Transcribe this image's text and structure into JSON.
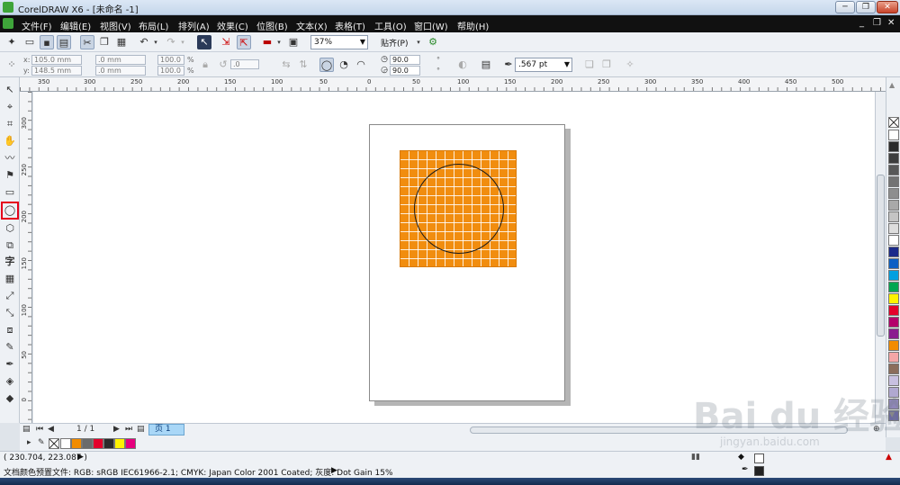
{
  "window": {
    "title": "CorelDRAW X6 - [未命名 -1]",
    "minimize": "─",
    "maximize": "❐",
    "close": "✕"
  },
  "menu": [
    "文件(F)",
    "编辑(E)",
    "视图(V)",
    "布局(L)",
    "排列(A)",
    "效果(C)",
    "位图(B)",
    "文本(X)",
    "表格(T)",
    "工具(O)",
    "窗口(W)",
    "帮助(H)"
  ],
  "mdi_buttons": [
    "_",
    "❐",
    "✕"
  ],
  "standard_toolbar": {
    "zoom": "37%",
    "snap": "贴齐(P)"
  },
  "property_bar": {
    "x_label": "x:",
    "x": "105.0 mm",
    "y_label": "y:",
    "y": "148.5 mm",
    "width": ".0 mm",
    "height": ".0 mm",
    "scale_w": "100.0",
    "scale_h": "100.0",
    "percent": "%",
    "rotation": ".0",
    "angle_start": "90.0",
    "angle_end": "90.0",
    "degree": "°",
    "outline": ".567 pt"
  },
  "ruler": {
    "h_ticks": [
      "350",
      "300",
      "250",
      "200",
      "150",
      "100",
      "50",
      "0",
      "50",
      "100",
      "150",
      "200",
      "250",
      "300",
      "350",
      "400",
      "450",
      "500"
    ],
    "v_ticks": [
      "300",
      "250",
      "200",
      "150",
      "100",
      "50",
      "0"
    ]
  },
  "toolbox_icons": [
    "pick-tool",
    "shape-tool",
    "crop-tool",
    "zoom-tool",
    "freehand-tool",
    "smart-fill-tool",
    "rectangle-tool",
    "ellipse-tool",
    "polygon-tool",
    "basic-shapes-tool",
    "text-tool",
    "table-tool",
    "dimension-tool",
    "connector-tool",
    "blend-tool",
    "eyedropper-tool",
    "outline-tool",
    "fill-tool",
    "interactive-fill-tool"
  ],
  "palette_colors": [
    "#ffffff",
    "#2b2b2b",
    "#3d3d3d",
    "#585858",
    "#737373",
    "#8e8e8e",
    "#a9a9a9",
    "#c4c4c4",
    "#dddddd",
    "#ffffff",
    "#1b2a8a",
    "#0a5fc4",
    "#00a0e0",
    "#00a650",
    "#fff200",
    "#e4002b",
    "#b4006b",
    "#8b1d8f",
    "#f28c00",
    "#f4a6a6",
    "#8b6d5b",
    "#c8c0e0",
    "#b0a8d0",
    "#8f86b8",
    "#6c6aa0"
  ],
  "page_bar": {
    "page_count": "1 / 1",
    "page_tab": "页 1"
  },
  "doc_palette": [
    "#ffffff",
    "#f28c00",
    "#6b6b6b",
    "#e4002b",
    "#2b2b2b",
    "#fff200",
    "#e6007e"
  ],
  "status": {
    "coords": "( 230.704, 223.087 )",
    "color_profile": "文档颜色预置文件: RGB: sRGB IEC61966-2.1; CMYK: Japan Color 2001 Coated; 灰度: Dot Gain 15%"
  },
  "watermark": {
    "text": "Bai du 经验",
    "url": "jingyan.baidu.com"
  }
}
